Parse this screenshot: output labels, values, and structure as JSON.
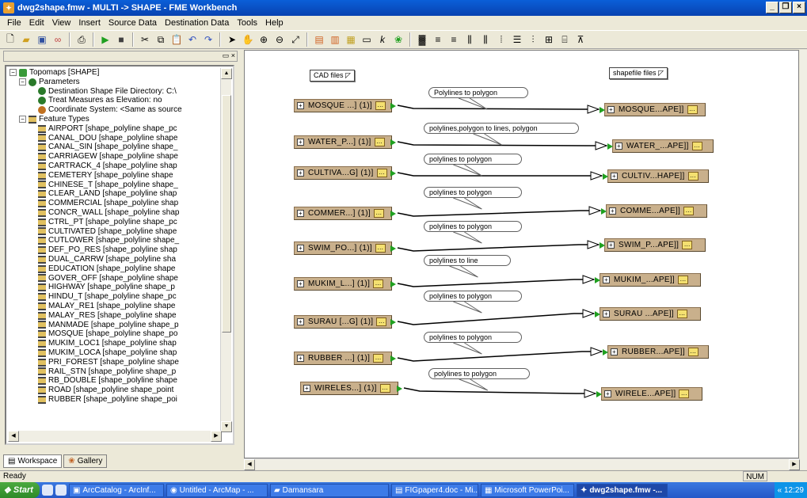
{
  "window": {
    "title": "dwg2shape.fmw - MULTI -> SHAPE - FME Workbench"
  },
  "menu": [
    "File",
    "Edit",
    "View",
    "Insert",
    "Source Data",
    "Destination Data",
    "Tools",
    "Help"
  ],
  "tree": {
    "root": "Topomaps [SHAPE]",
    "parameters_label": "Parameters",
    "parameters": [
      "Destination Shape File Directory: C:\\",
      "Treat Measures as Elevation: no",
      "Coordinate System: <Same as source"
    ],
    "feature_types_label": "Feature Types",
    "feature_types": [
      "AIRPORT [shape_polyline shape_pc",
      "CANAL_DOU [shape_polyline shape",
      "CANAL_SIN [shape_polyline shape_",
      "CARRIAGEW [shape_polyline shape",
      "CARTRACK_4 [shape_polyline shap",
      "CEMETERY [shape_polyline shape",
      "CHINESE_T [shape_polyline shape_",
      "CLEAR_LAND [shape_polyline shap",
      "COMMERCIAL [shape_polyline shap",
      "CONCR_WALL [shape_polyline shap",
      "CTRL_PT [shape_polyline shape_pc",
      "CULTIVATED [shape_polyline shape",
      "CUTLOWER [shape_polyline shape_",
      "DEF_PO_RES [shape_polyline shap",
      "DUAL_CARRW [shape_polyline sha",
      "EDUCATION [shape_polyline shape",
      "GOVER_OFF [shape_polyline shape",
      "HIGHWAY [shape_polyline shape_p",
      "HINDU_T [shape_polyline shape_pc",
      "MALAY_RE1 [shape_polyline shape",
      "MALAY_RES [shape_polyline shape",
      "MANMADE [shape_polyline shape_p",
      "MOSQUE [shape_polyline shape_po",
      "MUKIM_LOC1 [shape_polyline shap",
      "MUKIM_LOCA [shape_polyline shap",
      "PRI_FOREST [shape_polyline shape",
      "RAIL_STN [shape_polyline shape_p",
      "RB_DOUBLE [shape_polyline shape",
      "ROAD [shape_polyline shape_point",
      "RUBBER [shape_polyline shape_poi"
    ]
  },
  "tabs": {
    "workspace": "Workspace",
    "gallery": "Gallery"
  },
  "canvas": {
    "cad_label": "CAD files",
    "shape_label": "shapefile files",
    "sources": [
      "MOSQUE ...] (1)]",
      "WATER_P...] (1)]",
      "CULTIVA...G] (1)]",
      "COMMER...] (1)]",
      "SWIM_PO...] (1)]",
      "MUKIM_L...] (1)]",
      "SURAU [...G] (1)]",
      "RUBBER ...] (1)]",
      "WIRELES...] (1)]"
    ],
    "dests": [
      "MOSQUE...APE]]",
      "WATER_...APE]]",
      "CULTIV...HAPE]]",
      "COMME...APE]]",
      "SWIM_P...APE]]",
      "MUKIM_...APE]]",
      "SURAU ...APE]]",
      "RUBBER...APE]]",
      "WIRELE...APE]]"
    ],
    "notes": [
      "Polylines to polygon",
      "polylines,polygon to lines, polygon",
      "polylines to polygon",
      "polylines to polygon",
      "polylines to polygon",
      "polylines to line",
      "polylines to polygon",
      "polylines to polygon",
      "polylines to polygon"
    ]
  },
  "status": {
    "text": "Ready",
    "num": "NUM"
  },
  "taskbar": {
    "start": "Start",
    "tasks": [
      "ArcCatalog - ArcInf...",
      "Untitled - ArcMap - ...",
      "Damansara",
      "FIGpaper4.doc - Mi...",
      "Microsoft PowerPoi...",
      "dwg2shape.fmw -..."
    ],
    "clock": "12:29"
  }
}
